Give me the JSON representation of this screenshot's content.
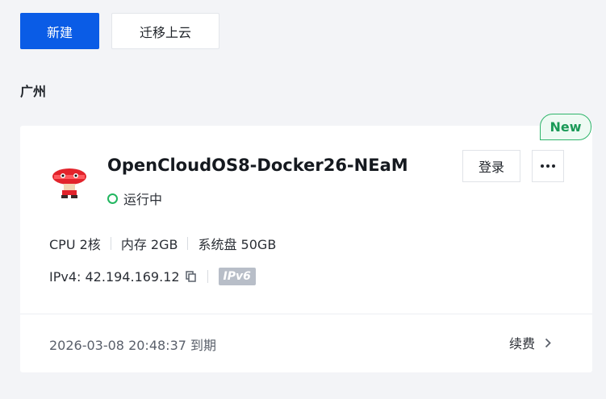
{
  "toolbar": {
    "new_label": "新建",
    "migrate_label": "迁移上云"
  },
  "region": "广州",
  "instance": {
    "badge": "New",
    "name": "OpenCloudOS8-Docker26-NEaM",
    "status": "运行中",
    "login_label": "登录",
    "more_label": "...",
    "specs": {
      "cpu": "CPU 2核",
      "memory": "内存 2GB",
      "disk": "系统盘 50GB"
    },
    "ipv4": "IPv4: 42.194.169.12",
    "ipv6_tag": "IPv6",
    "expire": "2026-03-08 20:48:37 到期",
    "renew_label": "续费"
  },
  "colors": {
    "primary": "#0a5ce6",
    "status_ok": "#22b660",
    "badge": "#1a9a57"
  }
}
